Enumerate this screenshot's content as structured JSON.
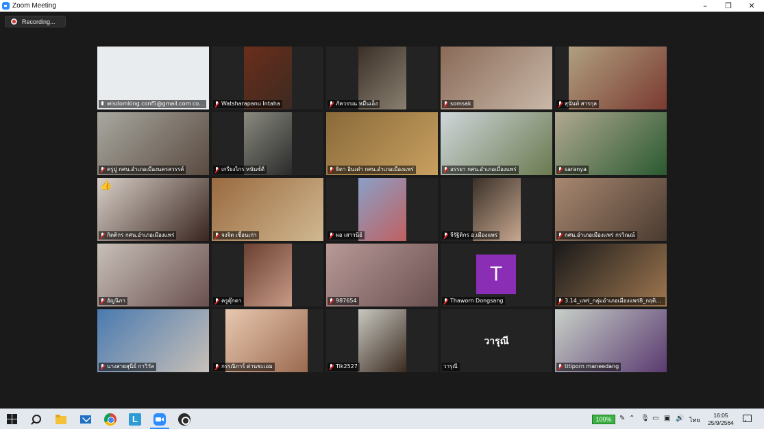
{
  "window": {
    "title": "Zoom Meeting",
    "controls": {
      "minimize": "–",
      "maximize": "❐",
      "close": "✕"
    }
  },
  "recording": {
    "label": "Recording..."
  },
  "participants": [
    {
      "name": "wisdomking.conf5@gmail.com co...",
      "mic": "on",
      "active": true
    },
    {
      "name": "Watsharapanu Intaha",
      "mic": "muted"
    },
    {
      "name": "ภัควรรณ หมื่นเอ็ง",
      "mic": "muted"
    },
    {
      "name": "somsak",
      "mic": "muted"
    },
    {
      "name": "สุนันท์ สารกุล",
      "mic": "muted"
    },
    {
      "name": "ครูปู กศน.อำเภอเมืองนครสวรรค์",
      "mic": "muted"
    },
    {
      "name": "เกรียงไกร หนันซ์ดี",
      "mic": "muted"
    },
    {
      "name": "ธิดา อินเต๋า กศน.อำเภอเมืองแพร่",
      "mic": "muted"
    },
    {
      "name": "อรรยา กศน.อำเภอเมืองแพร่",
      "mic": "muted"
    },
    {
      "name": "saranya",
      "mic": "muted"
    },
    {
      "name": "กิตติกร กศน.อำเภอเมืองแพร่",
      "mic": "muted",
      "reaction": "👍"
    },
    {
      "name": "จงจิต เชื้อนเก่า",
      "mic": "muted"
    },
    {
      "name": "ผอ เสาวนีย์",
      "mic": "muted"
    },
    {
      "name": "จีรัฐิติกร อ.เมืองแพร่",
      "mic": "muted"
    },
    {
      "name": "กศน.อำเภอเมืองแพร่ กรวิณณ์",
      "mic": "muted"
    },
    {
      "name": "อัญนิภา",
      "mic": "muted"
    },
    {
      "name": "ครูตุ๊กตา",
      "mic": "muted"
    },
    {
      "name": "987654",
      "mic": "muted"
    },
    {
      "name": "Thaworn Dongsang",
      "mic": "muted",
      "avatar_letter": "T"
    },
    {
      "name": "3.14_แพร่_กลุ่มอำเภอเมืองแพร่8_กฤติกา ...",
      "mic": "muted"
    },
    {
      "name": "นางสายสุนีย์ กาวิวัล",
      "mic": "muted"
    },
    {
      "name": "กรรณิการ์ ด่านชะเอม",
      "mic": "muted"
    },
    {
      "name": "Tik2527",
      "mic": "muted"
    },
    {
      "name": "วารุณี",
      "mic": "none",
      "display_name": "วารุณี"
    },
    {
      "name": "titiporn maneedang",
      "mic": "muted"
    }
  ],
  "taskbar": {
    "pinned_icons": [
      "windows-start-icon",
      "search-icon",
      "file-explorer-icon",
      "mail-icon",
      "chrome-icon",
      "line-icon",
      "zoom-icon",
      "obs-icon"
    ],
    "line_letter": "L",
    "battery": "100%",
    "language": "ไทย",
    "time": "16:05",
    "date": "25/9/2564"
  },
  "colors": {
    "active_speaker": "#a6e04a",
    "avatar_purple": "#8a2fb5",
    "muted_red": "#e02828",
    "battery_green": "#3cb043"
  }
}
